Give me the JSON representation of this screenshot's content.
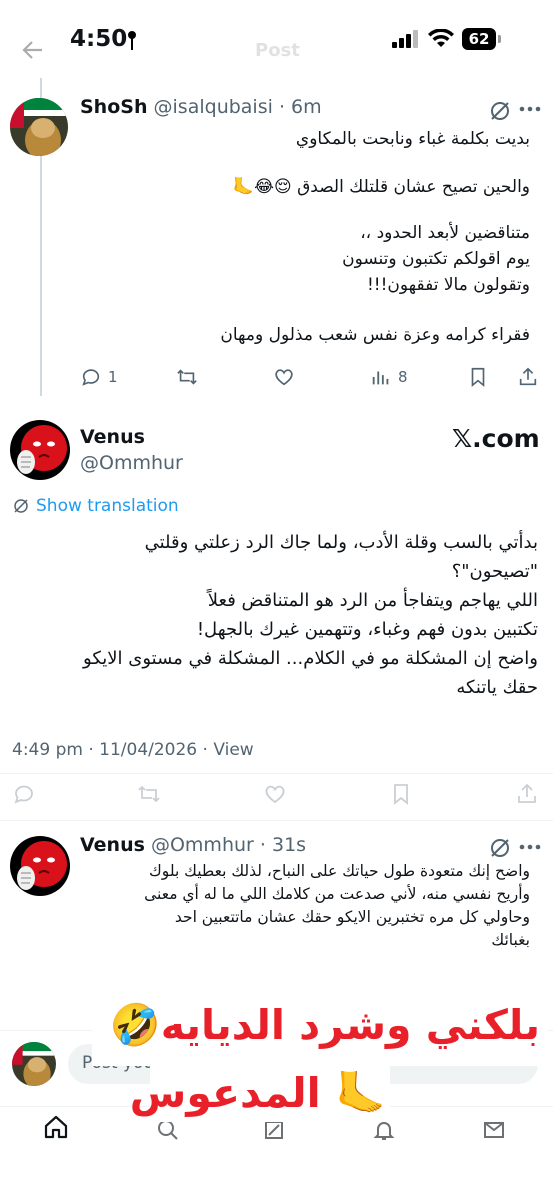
{
  "status_bar": {
    "time": "4:50",
    "battery": "62"
  },
  "top_bar": {
    "ghost_title": "Post"
  },
  "tweet1": {
    "display_name": "ShoSh",
    "handle": "@isalqubaisi",
    "dot": "·",
    "age": "6m",
    "lines": [
      "بديت بكلمة غباء ونابحت بالمكاوي",
      "والحين تصيح عشان قلتلك الصدق 😌😂🦶",
      "متناقضين لأبعد الحدود ،،",
      "يوم اقولكم تكتبون وتنسون",
      "وتقولون مالا تفقهون!!!",
      "فقراء كرامه وعزة نفس شعب مذلول ومهان"
    ],
    "reply_count": "1",
    "views": "8"
  },
  "tweet2": {
    "display_name": "Venus",
    "handle": "@Ommhur",
    "source": "𝕏.com",
    "show_translation": "Show translation",
    "lines": [
      "بدأتي بالسب وقلة الأدب، ولما جاك الرد زعلتي وقلتي",
      "\"تصيحون\"؟",
      "اللي يهاجم ويتفاجأ من الرد هو المتناقض فعلاً",
      "تكتبين بدون فهم وغباء، وتتهمين غيرك بالجهل!",
      "واضح إن المشكلة مو في الكلام... المشكلة في مستوى الايكو",
      "حقك ياتنكه"
    ],
    "meta": "4:49 pm · 11/04/2026 · View"
  },
  "tweet3": {
    "display_name": "Venus",
    "handle": "@Ommhur",
    "dot": "·",
    "age": "31s",
    "lines": [
      "واضح إنك متعودة طول حياتك على النباح، لذلك بعطيك بلوك",
      "وأريح نفسي منه، لأني صدعت من كلامك اللي ما له أي معنى",
      "وحاولي كل مره تختبرين الايكو حقك عشان ماتتعبين احد",
      "بغبائك"
    ]
  },
  "reply_bar": {
    "placeholder": "Post your reply"
  },
  "overlay": {
    "line1": "بلكني وشرد الديايه🤣",
    "line2": "🦶 المدعوس",
    "color": "#e8202a"
  },
  "colors": {
    "link": "#1d9bf0",
    "muted": "#536471"
  }
}
